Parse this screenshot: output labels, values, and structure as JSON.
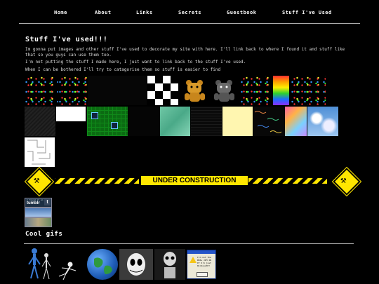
{
  "nav": {
    "home": "Home",
    "about": "About",
    "links": "Links",
    "secrets": "Secrets",
    "guestbook": "Guestbook",
    "stuff": "Stuff I've Used"
  },
  "page": {
    "title": "Stuff I've used!!!",
    "para1": "Im gonna put images and other stuff I've used to decorate my site with here. I'll link back to where I found it and stuff like that so you guys can use them too.",
    "para2": "I'm not putting the stuff I made here, I just want to link back to the stuff I've used.",
    "para3": "When I can be bothered I'll try to catagorise them so stuff is easier to find"
  },
  "banner": {
    "label": "UNDER CONSTRUCTION"
  },
  "badges": {
    "tumblr_top": "I found it on",
    "tumblr_word": "tumblr"
  },
  "section2": {
    "title": "Cool gifs"
  },
  "dialog_text": "I'm not the REAL JIM IN IT I'm just WindowsXP!"
}
